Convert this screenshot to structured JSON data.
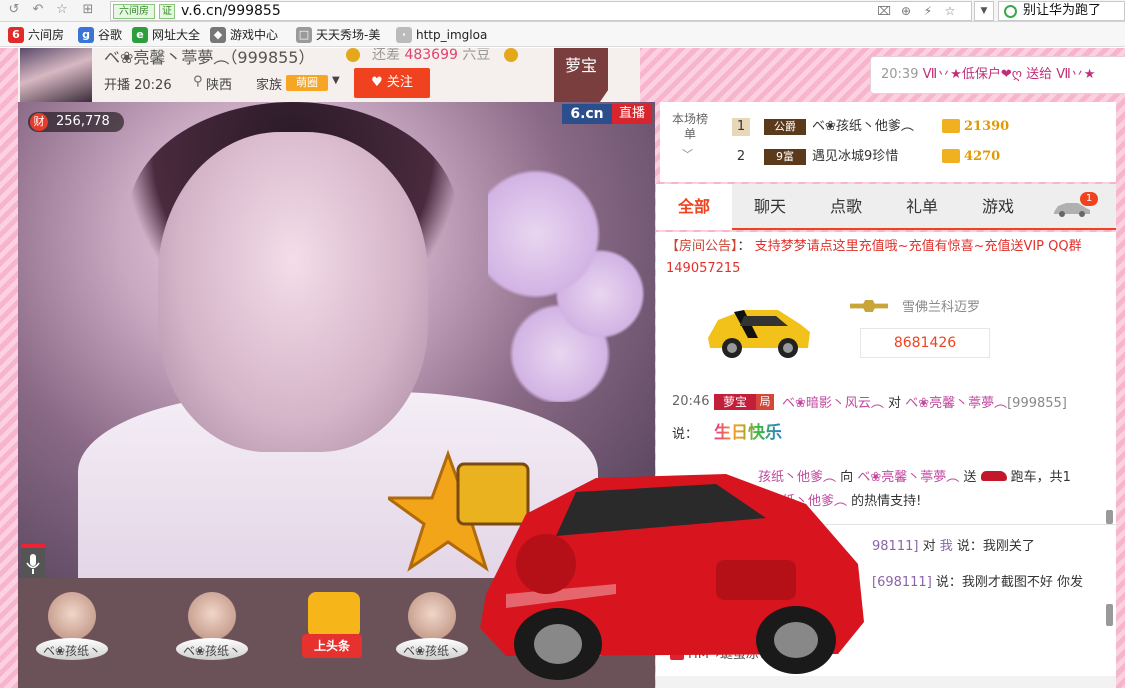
{
  "browser": {
    "url_badge": "六间房",
    "url_verified": "证",
    "url": "v.6.cn/999855",
    "search_text": "别让华为跑了"
  },
  "bookmarks": [
    {
      "label": "六间房",
      "color": "#e02b2b",
      "glyph": "6"
    },
    {
      "label": "谷歌",
      "color": "#3a74d6",
      "glyph": "g"
    },
    {
      "label": "网址大全",
      "color": "#2e9e3c",
      "glyph": "e"
    },
    {
      "label": "游戏中心",
      "color": "#777777",
      "glyph": "◆"
    },
    {
      "label": "天天秀场-美",
      "color": "#9a9a9a",
      "glyph": "□"
    },
    {
      "label": "http_imgloa",
      "color": "#bbbbbb",
      "glyph": "·"
    }
  ],
  "header": {
    "anchor_name": "ベ❀亮馨丶葶夢︵（999855）",
    "gap_label": "还差",
    "gap_value": "483699",
    "gap_unit": "六豆",
    "live_time": "开播 20:26",
    "location": "陕西",
    "family_label": "家族",
    "family_badge": "萌圈",
    "follow_label": "关注",
    "mengbao_tag": "萝宝"
  },
  "top_message": {
    "time": "20:39",
    "text": "Ⅶ丷★低保户❤ღ 送给 Ⅶ丷★"
  },
  "video": {
    "wealth_label": "财",
    "wealth_value": "256,778",
    "logo": "6.cn",
    "live_tag": "直播"
  },
  "gift_bar": [
    {
      "label": "ベ❀孩纸丶"
    },
    {
      "label": "ベ❀孩纸丶"
    },
    {
      "label": "上头条"
    },
    {
      "label": "ベ❀孩纸丶"
    },
    {
      "label": "ベ❀孩纸丶"
    }
  ],
  "rank": {
    "label": "本场榜单",
    "rows": [
      {
        "num": "1",
        "level": "公爵",
        "name": "ベ❀孩纸丶他爹︵",
        "score": "21390"
      },
      {
        "num": "2",
        "level": "9富",
        "name": "遇见冰城9珍惜",
        "score": "4270"
      }
    ]
  },
  "tabs": [
    {
      "label": "全部"
    },
    {
      "label": "聊天"
    },
    {
      "label": "点歌"
    },
    {
      "label": "礼单"
    },
    {
      "label": "游戏"
    }
  ],
  "tab_badge": "1",
  "chat": {
    "notice_title": "【房间公告】",
    "notice_sep": "：",
    "notice_text": "支持梦梦请点这里充值哦~充值有惊喜~充值送VIP QQ群149057215",
    "car_brand": "雪佛兰科迈罗",
    "car_id": "8681426",
    "msg1_time": "20:46",
    "msg1_tag": "萝宝",
    "msg1_tag2": "局",
    "msg1_user": "ベ❀暗影丶风云︵",
    "msg1_to": "对",
    "msg1_target": "ベ❀亮馨丶葶夢︵",
    "msg1_id": "[999855]",
    "msg1_say": "说：",
    "msg1_content": "生日快乐",
    "gift_user": "孩纸丶他爹︵",
    "gift_to": "向",
    "gift_target": "ベ❀亮馨丶葶夢︵",
    "gift_send": "送",
    "gift_item": "跑车，共1",
    "gift2_user": "纸丶他爹︵",
    "gift2_text": "的热情支持!",
    "lower1_id": "98111]",
    "lower1_to": "对",
    "lower1_me": "我",
    "lower1_text": "说：我刚关了",
    "lower2_id": "[698111]",
    "lower2_text": "说：我刚才截图不好 你发",
    "hm_text": "HM→蜓蛋凉：b"
  }
}
